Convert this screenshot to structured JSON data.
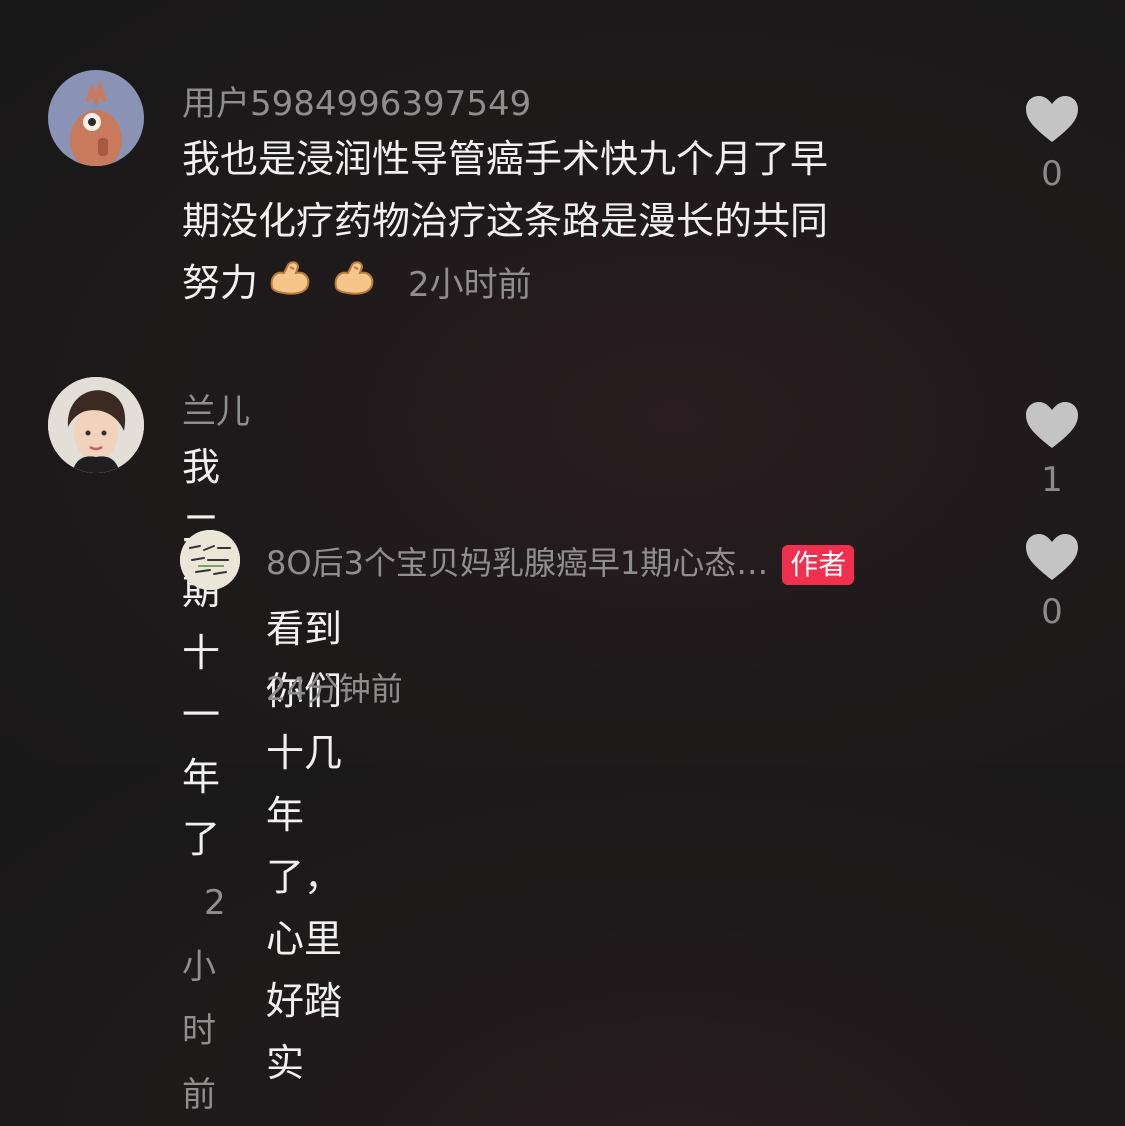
{
  "comments": [
    {
      "username": "用户5984996397549",
      "text_lines": [
        "我也是浸润性导管癌手术快九个月了早",
        "期没化疗药物治疗这条路是漫长的共同",
        "努力"
      ],
      "emoji": "flexed-biceps",
      "time": "2小时前",
      "likes": "0"
    },
    {
      "username": "兰儿",
      "text": "我二期十一年了",
      "time": "2小时前",
      "likes": "1"
    }
  ],
  "reply": {
    "username": "8O后3个宝贝妈乳腺癌早1期心态…",
    "badge": "作者",
    "text": "看到你们十几年了，心里好踏实",
    "time": "24分钟前",
    "likes": "0"
  },
  "colors": {
    "badge": "#f0304e",
    "muted": "#8e8e8e",
    "text": "#f1f1f1",
    "heart": "#c4c4c4"
  }
}
